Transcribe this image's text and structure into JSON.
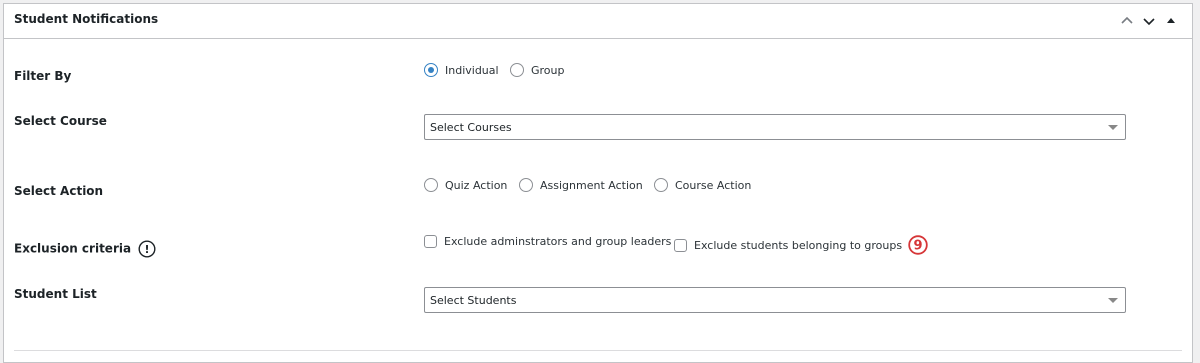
{
  "panel": {
    "title": "Student Notifications",
    "header_icons": [
      "chevron-up-icon",
      "chevron-down-icon",
      "toggle-arrow-icon"
    ]
  },
  "rows": {
    "filter_by": {
      "label": "Filter By",
      "options": [
        {
          "label": "Individual",
          "checked": true
        },
        {
          "label": "Group",
          "checked": false
        }
      ]
    },
    "select_course": {
      "label": "Select Course",
      "value": "Select Courses"
    },
    "select_action": {
      "label": "Select Action",
      "options": [
        {
          "label": "Quiz Action",
          "checked": false
        },
        {
          "label": "Assignment Action",
          "checked": false
        },
        {
          "label": "Course Action",
          "checked": false
        }
      ]
    },
    "exclusion": {
      "label": "Exclusion criteria",
      "info_icon": "!",
      "options": [
        {
          "label": "Exclude adminstrators and group leaders",
          "checked": false
        },
        {
          "label": "Exclude students belonging to groups",
          "checked": false
        }
      ],
      "badge": "9"
    },
    "student_list": {
      "label": "Student List",
      "value": "Select Students"
    }
  },
  "colors": {
    "accent": "#3582c4",
    "badge": "#d63638",
    "border": "#c3c4c7"
  }
}
